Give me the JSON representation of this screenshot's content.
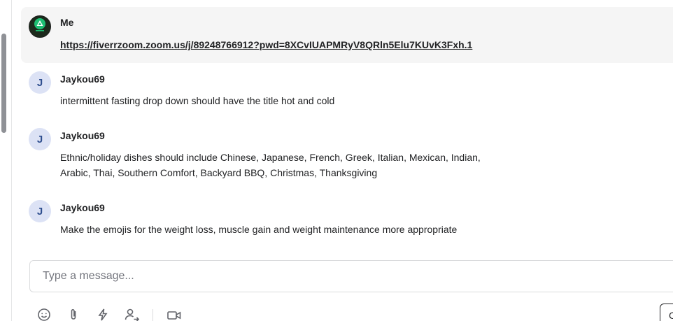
{
  "messages": [
    {
      "sender": "Me",
      "avatar_icon": "fiverr-logo-icon",
      "link": "https://fiverrzoom.zoom.us/j/89248766912?pwd=8XCvIUAPMRyV8QRln5Elu7KUvK3Fxh.1"
    },
    {
      "sender": "Jaykou69",
      "avatar_letter": "J",
      "lines": [
        "intermittent fasting drop down should have the title hot and cold"
      ]
    },
    {
      "sender": "Jaykou69",
      "avatar_letter": "J",
      "lines": [
        "Ethnic/holiday dishes should include Chinese, Japanese, French, Greek, Italian, Mexican, Indian,",
        "Arabic, Thai, Southern Comfort, Backyard BBQ, Christmas, Thanksgiving"
      ]
    },
    {
      "sender": "Jaykou69",
      "avatar_letter": "J",
      "lines": [
        "Make the emojis for the weight loss, muscle gain and weight maintenance more appropriate"
      ]
    }
  ],
  "composer": {
    "placeholder": "Type a message...",
    "value": ""
  },
  "toolbar": {
    "icons": [
      "emoji-icon",
      "attachment-icon",
      "quick-response-icon",
      "share-contact-icon",
      "video-call-icon"
    ]
  },
  "send_button": {
    "label": "C"
  },
  "colors": {
    "avatar_bg": "#dce2f5",
    "avatar_letter": "#2f4f8f",
    "highlight_bg": "#f5f5f5",
    "me_avatar_accent": "#1dbf73"
  }
}
